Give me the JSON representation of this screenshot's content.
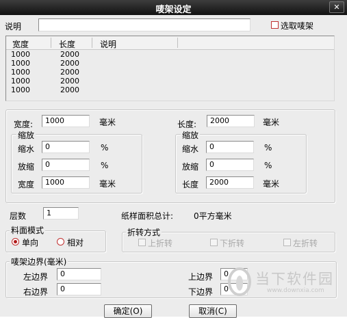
{
  "window": {
    "title": "唛架设定",
    "close_glyph": "✕"
  },
  "description": {
    "label": "说明",
    "value": ""
  },
  "select_marker": {
    "label": "选取唛架",
    "checked": false
  },
  "list": {
    "columns": [
      "宽度",
      "长度",
      "说明"
    ],
    "rows": [
      [
        "1000",
        "2000",
        ""
      ],
      [
        "1000",
        "2000",
        ""
      ],
      [
        "1000",
        "2000",
        ""
      ],
      [
        "1000",
        "2000",
        ""
      ],
      [
        "1000",
        "2000",
        ""
      ]
    ]
  },
  "width_section": {
    "label": "宽度:",
    "value": "1000",
    "unit": "毫米",
    "scale_title": "缩放",
    "shrink_label": "缩水",
    "shrink_value": "0",
    "shrink_unit": "%",
    "stretch_label": "放缩",
    "stretch_value": "0",
    "stretch_unit": "%",
    "result_label": "宽度",
    "result_value": "1000",
    "result_unit": "毫米"
  },
  "length_section": {
    "label": "长度:",
    "value": "2000",
    "unit": "毫米",
    "scale_title": "缩放",
    "shrink_label": "缩水",
    "shrink_value": "0",
    "shrink_unit": "%",
    "stretch_label": "放缩",
    "stretch_value": "0",
    "stretch_unit": "%",
    "result_label": "长度",
    "result_value": "2000",
    "result_unit": "毫米"
  },
  "layers": {
    "label": "层数",
    "value": "1"
  },
  "area": {
    "label": "纸样面积总计:",
    "value": "0平方毫米"
  },
  "fabric_mode": {
    "title": "料面模式",
    "options": [
      "单向",
      "相对"
    ],
    "selected": 0
  },
  "fold_mode": {
    "title": "折转方式",
    "options": [
      "上折转",
      "下折转",
      "左折转"
    ]
  },
  "margins": {
    "title": "唛架边界(毫米)",
    "left_label": "左边界",
    "left_value": "0",
    "right_label": "右边界",
    "right_value": "0",
    "top_label": "上边界",
    "top_value": "0",
    "bottom_label": "下边界",
    "bottom_value": "0"
  },
  "buttons": {
    "ok": "确定(O)",
    "cancel": "取消(C)"
  },
  "watermark": {
    "name": "当下软件园",
    "url": "www.downxia.com"
  }
}
